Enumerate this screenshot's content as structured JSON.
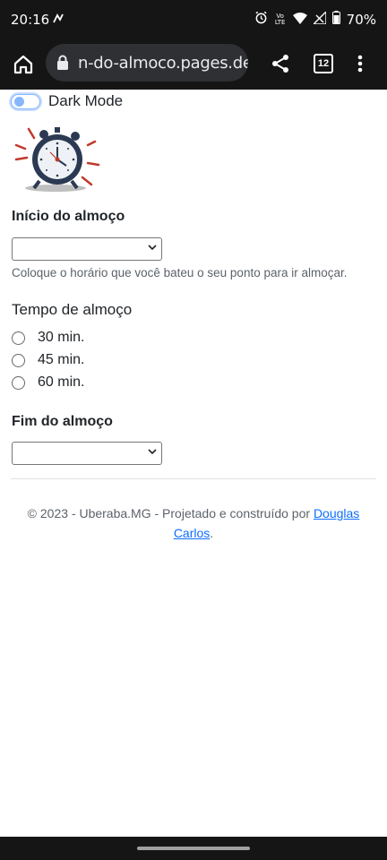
{
  "status_bar": {
    "time": "20:16",
    "network_label": "Vo LTE",
    "battery": "70%"
  },
  "browser": {
    "url": "n-do-almoco.pages.dev",
    "tab_count": "12"
  },
  "toggle": {
    "label": "Dark Mode"
  },
  "form": {
    "start_label": "Início do almoço",
    "start_value": "",
    "start_help": "Coloque o horário que você bateu o seu ponto para ir almoçar.",
    "duration_label": "Tempo de almoço",
    "duration_options": [
      "30 min.",
      "45 min.",
      "60 min."
    ],
    "end_label": "Fim do almoço",
    "end_value": ""
  },
  "footer": {
    "text": "© 2023 - Uberaba.MG - Projetado e construído por ",
    "link_part1": "Douglas",
    "link_part2": "Carlos",
    "suffix": "."
  },
  "colors": {
    "accent": "#0d6efd",
    "clock_body": "#2b3a52",
    "clock_rays": "#c0392b"
  }
}
